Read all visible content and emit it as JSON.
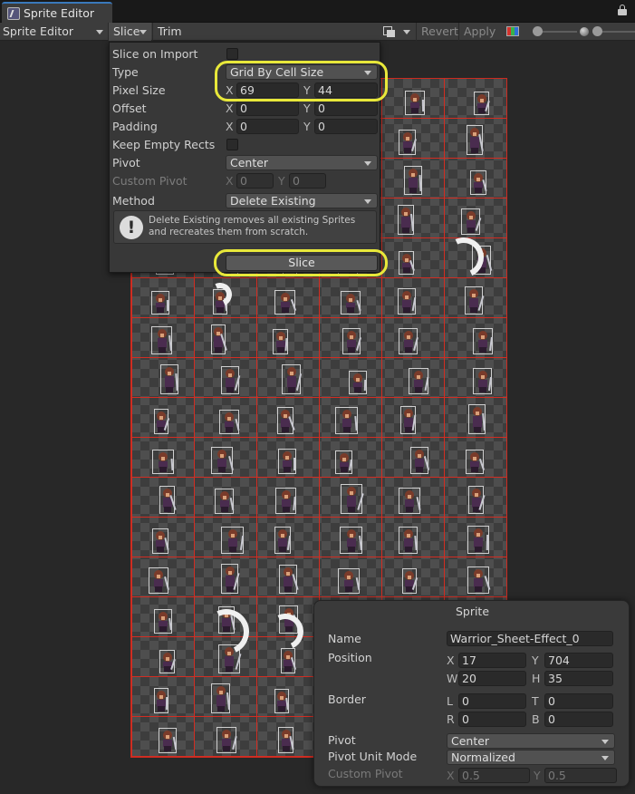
{
  "window": {
    "tab_title": "Sprite Editor",
    "tab_icon": "sprite-editor-icon",
    "lock_icon": "lock-icon"
  },
  "toolbar": {
    "mode_dropdown": "Sprite Editor",
    "slice_menu": "Slice",
    "trim": "Trim",
    "revert": "Revert",
    "apply": "Apply"
  },
  "slice_popup": {
    "slice_on_import_label": "Slice on Import",
    "slice_on_import_checked": false,
    "type_label": "Type",
    "type_value": "Grid By Cell Size",
    "pixel_size_label": "Pixel Size",
    "pixel_size_x": "69",
    "pixel_size_y": "44",
    "offset_label": "Offset",
    "offset_x": "0",
    "offset_y": "0",
    "padding_label": "Padding",
    "padding_x": "0",
    "padding_y": "0",
    "keep_empty_label": "Keep Empty Rects",
    "keep_empty_checked": false,
    "pivot_label": "Pivot",
    "pivot_value": "Center",
    "custom_pivot_label": "Custom Pivot",
    "custom_pivot_x": "0",
    "custom_pivot_y": "0",
    "method_label": "Method",
    "method_value": "Delete Existing",
    "help_text": "Delete Existing removes all existing Sprites and recreates them from scratch.",
    "slice_button": "Slice",
    "axis_x": "X",
    "axis_y": "Y"
  },
  "sprite_panel": {
    "title": "Sprite",
    "name_label": "Name",
    "name_value": "Warrior_Sheet-Effect_0",
    "position_label": "Position",
    "x": "17",
    "y": "704",
    "w": "20",
    "h": "35",
    "border_label": "Border",
    "border_l": "0",
    "border_t": "0",
    "border_r": "0",
    "border_b": "0",
    "pivot_label": "Pivot",
    "pivot_value": "Center",
    "pivot_unit_label": "Pivot Unit Mode",
    "pivot_unit_value": "Normalized",
    "custom_pivot_label": "Custom Pivot",
    "custom_pivot_x": "0.5",
    "custom_pivot_y": "0.5",
    "labels": {
      "X": "X",
      "Y": "Y",
      "W": "W",
      "H": "H",
      "L": "L",
      "T": "T",
      "R": "R",
      "B": "B"
    }
  },
  "sheet": {
    "columns": 6,
    "rows": 17,
    "grid_color": "#d22d22"
  },
  "colors": {
    "highlight": "#e8e83a",
    "tab_accent": "#3a79bb"
  }
}
